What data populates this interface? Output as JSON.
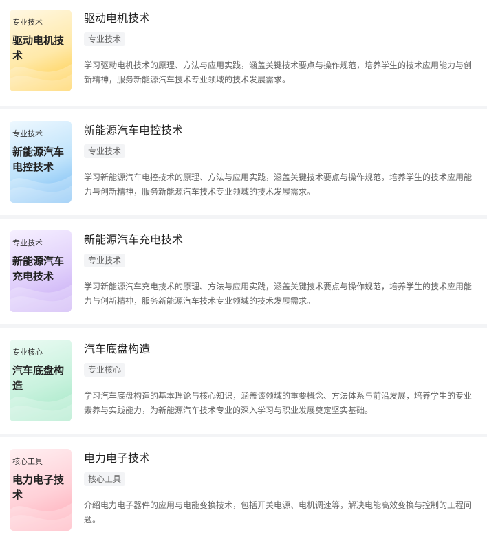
{
  "courses": [
    {
      "thumb_tag": "专业技术",
      "thumb_title": "驱动电机技术",
      "title": "驱动电机技术",
      "badge": "专业技术",
      "desc": "学习驱动电机技术的原理、方法与应用实践，涵盖关键技术要点与操作规范，培养学生的技术应用能力与创新精神，服务新能源汽车技术专业领域的技术发展需求。",
      "theme": "yellow"
    },
    {
      "thumb_tag": "专业技术",
      "thumb_title": "新能源汽车电控技术",
      "title": "新能源汽车电控技术",
      "badge": "专业技术",
      "desc": "学习新能源汽车电控技术的原理、方法与应用实践，涵盖关键技术要点与操作规范，培养学生的技术应用能力与创新精神，服务新能源汽车技术专业领域的技术发展需求。",
      "theme": "blue"
    },
    {
      "thumb_tag": "专业技术",
      "thumb_title": "新能源汽车充电技术",
      "title": "新能源汽车充电技术",
      "badge": "专业技术",
      "desc": "学习新能源汽车充电技术的原理、方法与应用实践，涵盖关键技术要点与操作规范，培养学生的技术应用能力与创新精神，服务新能源汽车技术专业领域的技术发展需求。",
      "theme": "purple"
    },
    {
      "thumb_tag": "专业核心",
      "thumb_title": "汽车底盘构造",
      "title": "汽车底盘构造",
      "badge": "专业核心",
      "desc": "学习汽车底盘构造的基本理论与核心知识，涵盖该领域的重要概念、方法体系与前沿发展，培养学生的专业素养与实践能力，为新能源汽车技术专业的深入学习与职业发展奠定坚实基础。",
      "theme": "green"
    },
    {
      "thumb_tag": "核心工具",
      "thumb_title": "电力电子技术",
      "title": "电力电子技术",
      "badge": "核心工具",
      "desc": "介绍电力电子器件的应用与电能变换技术，包括开关电源、电机调速等，解决电能高效变换与控制的工程问题。",
      "theme": "pink"
    }
  ]
}
